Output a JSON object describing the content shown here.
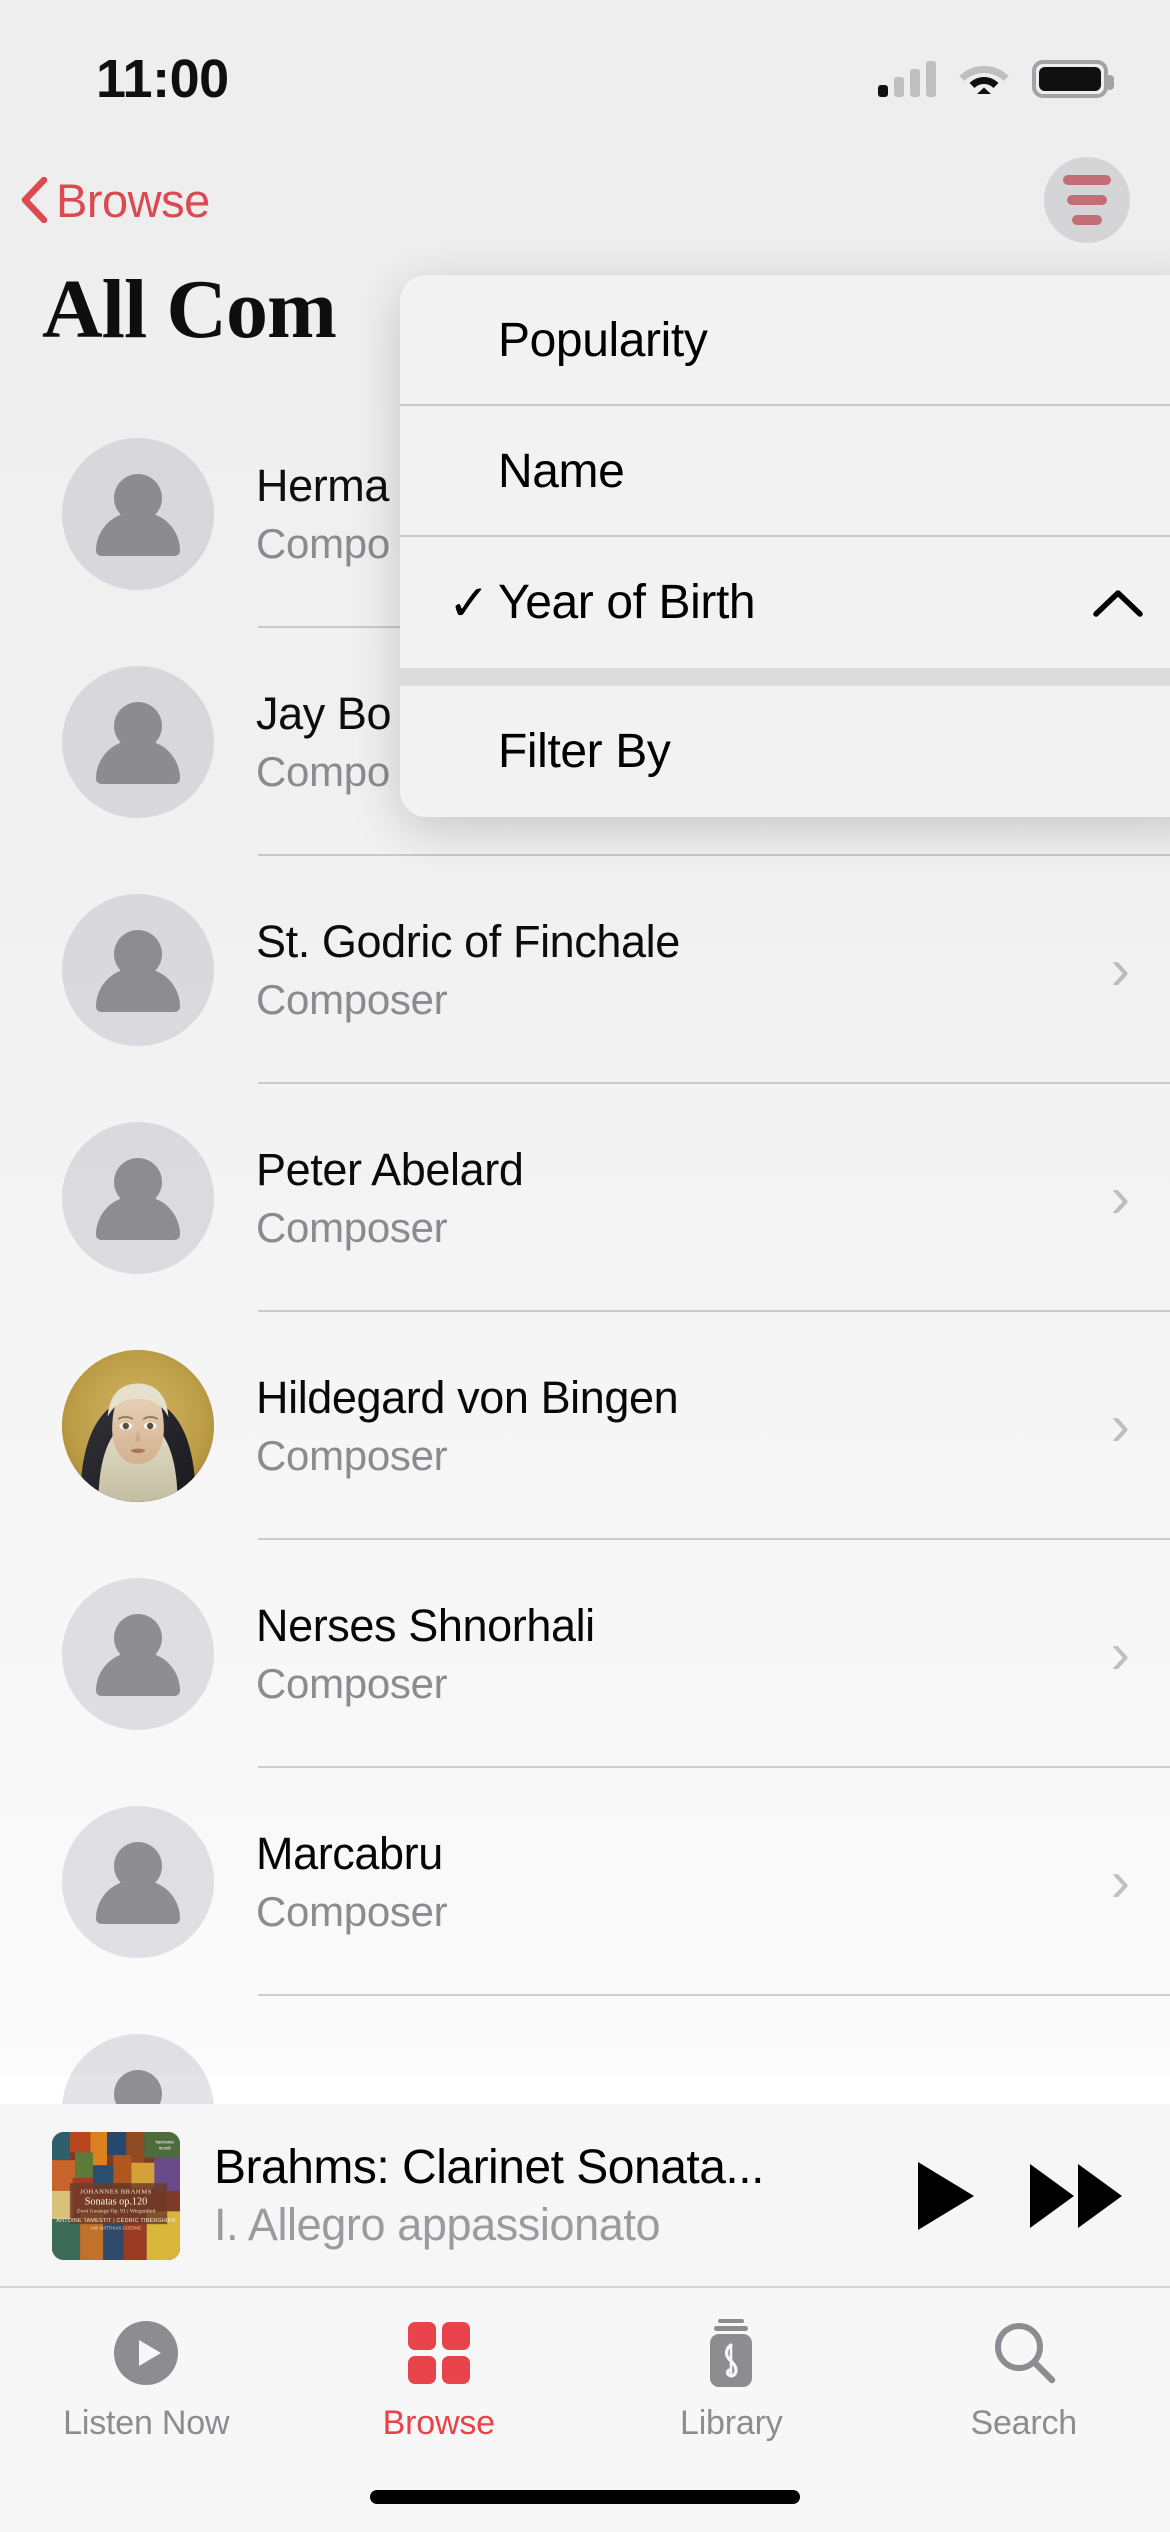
{
  "status_bar": {
    "time": "11:00",
    "cellular_icon": "signal-bars-icon",
    "cellular_bars_filled": 1,
    "cellular_bars_total": 4,
    "wifi_icon": "wifi-icon",
    "battery_icon": "battery-full-icon"
  },
  "nav_bar": {
    "back_label": "Browse",
    "back_icon": "chevron-left-icon",
    "filter_icon": "sort-filter-icon",
    "accent_color": "#e8434a"
  },
  "page_title": "All Com",
  "sort_menu": {
    "items": [
      {
        "label": "Popularity",
        "checked": false,
        "order_icon": ""
      },
      {
        "label": "Name",
        "checked": false,
        "order_icon": ""
      },
      {
        "label": "Year of Birth",
        "checked": true,
        "order_icon": "chevron-up-icon"
      }
    ],
    "footer_item": {
      "label": "Filter By"
    },
    "check_glyph": "✓"
  },
  "list": {
    "rows": [
      {
        "name": "Herma",
        "role": "Compo",
        "avatar": "person-placeholder-icon",
        "chevron": "chevron-right-icon"
      },
      {
        "name": "Jay Bo",
        "role": "Compo",
        "avatar": "person-placeholder-icon",
        "chevron": "chevron-right-icon"
      },
      {
        "name": "St. Godric of Finchale",
        "role": "Composer",
        "avatar": "person-placeholder-icon",
        "chevron": "chevron-right-icon"
      },
      {
        "name": "Peter Abelard",
        "role": "Composer",
        "avatar": "person-placeholder-icon",
        "chevron": "chevron-right-icon"
      },
      {
        "name": "Hildegard von Bingen",
        "role": "Composer",
        "avatar": "portrait-photo",
        "chevron": "chevron-right-icon"
      },
      {
        "name": "Nerses Shnorhali",
        "role": "Composer",
        "avatar": "person-placeholder-icon",
        "chevron": "chevron-right-icon"
      },
      {
        "name": "Marcabru",
        "role": "Composer",
        "avatar": "person-placeholder-icon",
        "chevron": "chevron-right-icon"
      }
    ]
  },
  "now_playing": {
    "title": "Brahms: Clarinet Sonata...",
    "subtitle": "I. Allegro appassionato",
    "artwork_alt": "JOHANNES BRAHMS Sonatas op.120",
    "artwork_lines": {
      "composer": "JOHANNES BRAHMS",
      "work": "Sonatas op.120",
      "sub": "Zwei Gesänge Op. 91 | Wiegenlied",
      "performers": "ANTOINE TAMESTIT | CÉDRIC TIBERGHIEN",
      "with": "with MATTHIAS GOERNE",
      "label": "harmonia mundi"
    },
    "play_icon": "play-icon",
    "next_icon": "fast-forward-icon"
  },
  "tab_bar": {
    "active_color": "#e8434a",
    "inactive_color": "#8c8c91",
    "tabs": [
      {
        "label": "Listen Now",
        "icon": "play-circle-icon",
        "active": false
      },
      {
        "label": "Browse",
        "icon": "grid-squares-icon",
        "active": true
      },
      {
        "label": "Library",
        "icon": "library-clef-icon",
        "active": false
      },
      {
        "label": "Search",
        "icon": "search-icon",
        "active": false
      }
    ]
  }
}
